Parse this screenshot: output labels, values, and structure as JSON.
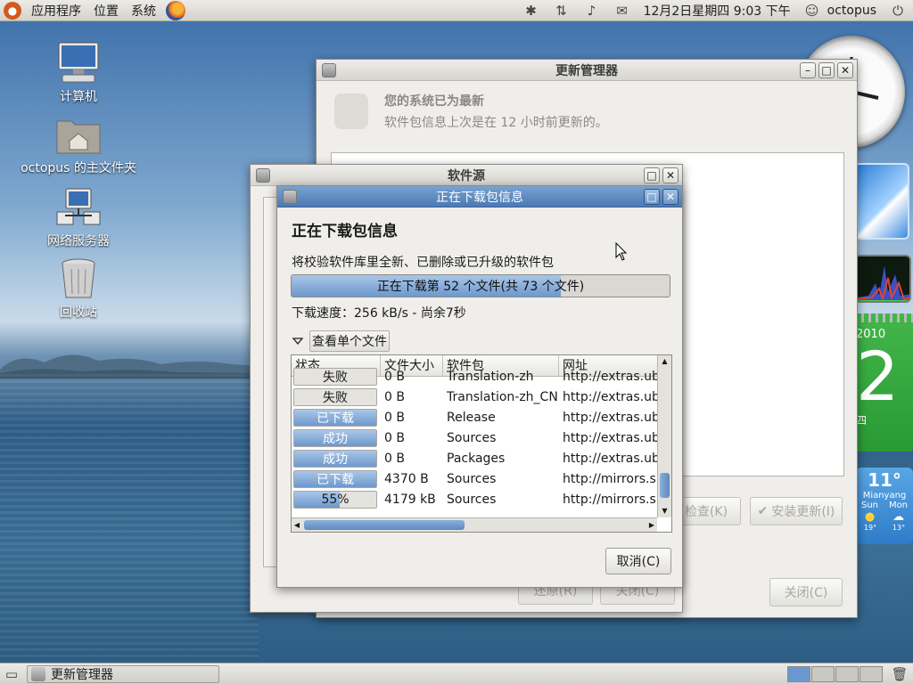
{
  "top_panel": {
    "menu": [
      "应用程序",
      "位置",
      "系统"
    ],
    "datetime": "12月2日星期四  9:03 下午",
    "user": "octopus"
  },
  "desktop_icons": [
    "计算机",
    "octopus 的主文件夹",
    "网络服务器",
    "回收站"
  ],
  "widgets": {
    "calendar_year": "2010",
    "calendar_day": "2",
    "calendar_weekday": "四",
    "weather_temp": "11°",
    "weather_city": "Mianyang",
    "weather_days": [
      "Sun",
      "Mon"
    ],
    "weather_lows": [
      "19°",
      "13°"
    ]
  },
  "update_manager": {
    "title": "更新管理器",
    "heading": "您的系统已为最新",
    "subtitle": "软件包信息上次是在 12 小时前更新的。",
    "check_button": "检查(K)",
    "install_button": "安装更新(I)",
    "close_button": "关闭(C)"
  },
  "software_sources": {
    "title": "软件源",
    "revert_button": "还原(R)",
    "close_button": "关闭(C)"
  },
  "download_dialog": {
    "title": "正在下载包信息",
    "heading": "正在下载包信息",
    "description": "将校验软件库里全新、已删除或已升级的软件包",
    "progress_text": "正在下载第 52 个文件(共 73 个文件)",
    "progress_fraction": 0.7123,
    "speed_text": "下载速度：256 kB/s - 尚余7秒",
    "expander_label": "查看单个文件",
    "columns": [
      "状态",
      "文件大小",
      "软件包",
      "网址"
    ],
    "rows": [
      {
        "status": "失败",
        "progress": 0,
        "size": "0 B",
        "package": "Translation-zh",
        "url": "http://extras.ub"
      },
      {
        "status": "失败",
        "progress": 0,
        "size": "0 B",
        "package": "Translation-zh_CN",
        "url": "http://extras.ub"
      },
      {
        "status": "已下载",
        "progress": 1,
        "size": "0 B",
        "package": "Release",
        "url": "http://extras.ub"
      },
      {
        "status": "成功",
        "progress": 1,
        "size": "0 B",
        "package": "Sources",
        "url": "http://extras.ub"
      },
      {
        "status": "成功",
        "progress": 1,
        "size": "0 B",
        "package": "Packages",
        "url": "http://extras.ub"
      },
      {
        "status": "已下载",
        "progress": 1,
        "size": "4370 B",
        "package": "Sources",
        "url": "http://mirrors.s"
      },
      {
        "status": "55%",
        "progress": 0.55,
        "size": "4179 kB",
        "package": "Sources",
        "url": "http://mirrors.s"
      }
    ],
    "cancel_button": "取消(C)"
  },
  "taskbar": {
    "task_label": "更新管理器"
  },
  "colors": {
    "accent": "#6d98cc",
    "titlebar_active": "#4b79b5"
  }
}
